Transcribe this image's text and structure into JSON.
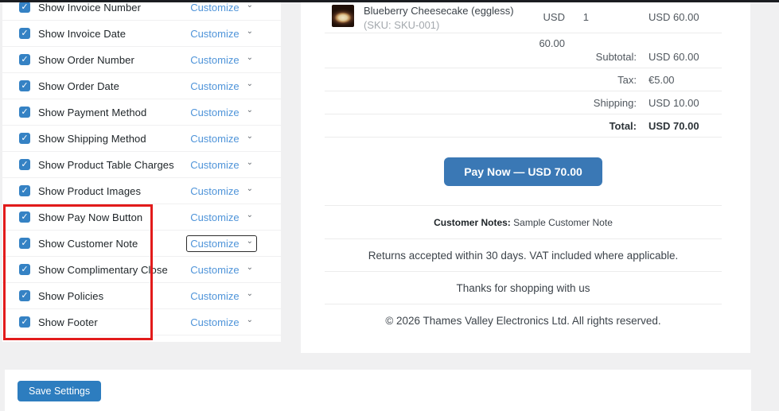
{
  "settings_panel": {
    "customize_label": "Customize",
    "rows": [
      {
        "label": "Show Invoice Number",
        "checked": true
      },
      {
        "label": "Show Invoice Date",
        "checked": true
      },
      {
        "label": "Show Order Number",
        "checked": true
      },
      {
        "label": "Show Order Date",
        "checked": true
      },
      {
        "label": "Show Payment Method",
        "checked": true
      },
      {
        "label": "Show Shipping Method",
        "checked": true
      },
      {
        "label": "Show Product Table Charges",
        "checked": true
      },
      {
        "label": "Show Product Images",
        "checked": true
      },
      {
        "label": "Show Pay Now Button",
        "checked": true
      },
      {
        "label": "Show Customer Note",
        "checked": true,
        "focused": true
      },
      {
        "label": "Show Complimentary Close",
        "checked": true
      },
      {
        "label": "Show Policies",
        "checked": true
      },
      {
        "label": "Show Footer",
        "checked": true
      }
    ],
    "checkbox_glyph": "✓",
    "chevron_glyph": "⌄"
  },
  "invoice_preview": {
    "product": {
      "name": "Blueberry Cheesecake (eggless)",
      "sku": "(SKU: SKU-001)",
      "price": "USD 60.00",
      "qty": "1",
      "line_total": "USD 60.00"
    },
    "totals": [
      {
        "label": "Subtotal:",
        "value": "USD 60.00"
      },
      {
        "label": "Tax:",
        "value": "€5.00"
      },
      {
        "label": "Shipping:",
        "value": "USD 10.00"
      },
      {
        "label": "Total:",
        "value": "USD 70.00"
      }
    ],
    "pay_button_label": "Pay Now — USD 70.00",
    "customer_notes_label": "Customer Notes:",
    "customer_notes_value": " Sample Customer Note",
    "policies_text": "Returns accepted within 30 days. VAT included where applicable.",
    "closing_text": "Thanks for shopping with us",
    "footer_text": "© 2026 Thames Valley Electronics Ltd. All rights reserved."
  },
  "footer_bar": {
    "save_button_label": "Save Settings"
  },
  "colors": {
    "checkbox_blue": "#3582c4",
    "link_blue": "#4f94d9",
    "pay_button_blue": "#3a78b5",
    "save_button_blue": "#2d7dbf",
    "annotation_red": "#e21b1b",
    "page_background": "#f0f0f1"
  }
}
